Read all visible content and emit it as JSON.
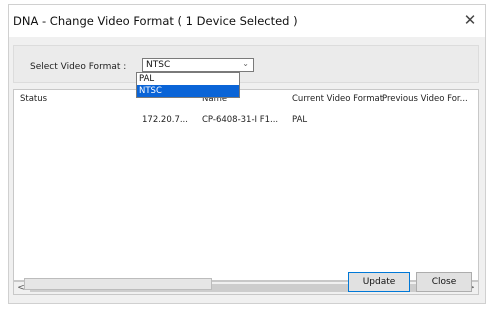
{
  "window": {
    "title": "DNA - Change Video Format ( 1 Device Selected )",
    "close_glyph": "✕"
  },
  "format": {
    "label": "Select Video Format :",
    "selected": "NTSC",
    "options": [
      "PAL",
      "NTSC"
    ],
    "highlighted_option": "NTSC"
  },
  "table": {
    "columns": [
      "Status",
      "",
      "Name",
      "Current Video Format",
      "Previous Video For..."
    ],
    "rows": [
      [
        "",
        "172.20.7...",
        "CP-6408-31-I F1...",
        "PAL",
        ""
      ]
    ]
  },
  "scrollbar": {
    "left_glyph": "<",
    "right_glyph": ">"
  },
  "buttons": {
    "update": "Update",
    "close": "Close"
  },
  "colors": {
    "selection": "#0a64d7",
    "default_button_border": "#0078d7"
  }
}
